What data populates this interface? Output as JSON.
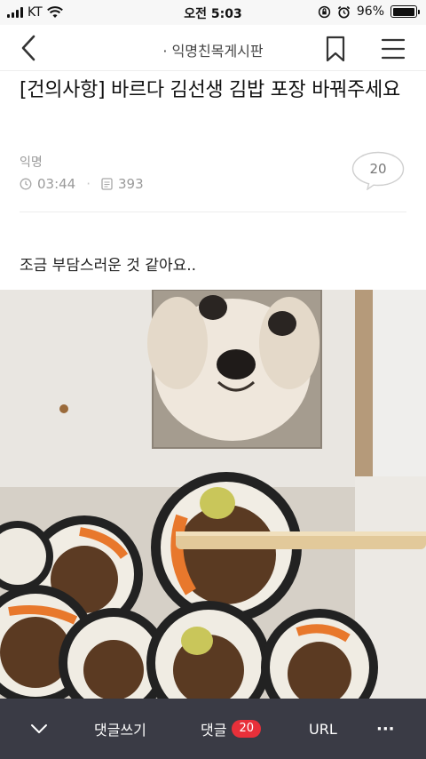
{
  "status_bar": {
    "carrier": "KT",
    "time": "오전 5:03",
    "battery": "96%",
    "battery_level": 0.96
  },
  "header": {
    "title": "· 익명친목게시판"
  },
  "post": {
    "title": "[건의사항] 바르다 김선생 김밥 포장 바꿔주세요",
    "author": "익명",
    "time": "03:44",
    "views": "393",
    "comment_count": "20",
    "body": "조금 부담스러운 것 같아요.."
  },
  "toolbar": {
    "write_comment": "댓글쓰기",
    "comments_label": "댓글",
    "comments_count": "20",
    "url_label": "URL",
    "more_label": "···"
  },
  "colors": {
    "toolbar_bg": "#3a3b45",
    "badge": "#e8303a",
    "meta_text": "#9a9a9a"
  }
}
